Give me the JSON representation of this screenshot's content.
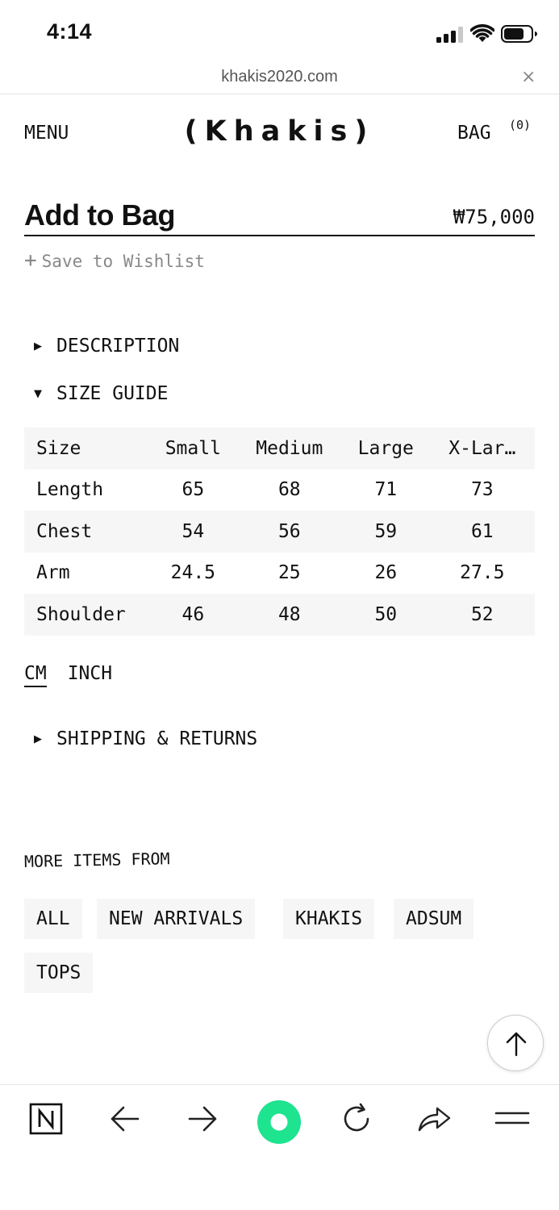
{
  "status_bar": {
    "time": "4:14"
  },
  "browser": {
    "url": "khakis2020.com",
    "close_symbol": "×"
  },
  "header": {
    "menu_label": "MENU",
    "logo": "(Khakis)",
    "bag_label": "BAG",
    "bag_count": "(0)"
  },
  "product": {
    "add_to_bag_label": "Add to Bag",
    "price": "₩75,000",
    "wishlist_plus": "+",
    "wishlist_label": "Save to Wishlist"
  },
  "accordions": {
    "description": "DESCRIPTION",
    "size_guide": "SIZE GUIDE",
    "shipping": "SHIPPING & RETURNS"
  },
  "size_table": {
    "headers": [
      "Size",
      "Small",
      "Medium",
      "Large",
      "X-Lar…"
    ],
    "rows": [
      [
        "Length",
        "65",
        "68",
        "71",
        "73"
      ],
      [
        "Chest",
        "54",
        "56",
        "59",
        "61"
      ],
      [
        "Arm",
        "24.5",
        "25",
        "26",
        "27.5"
      ],
      [
        "Shoulder",
        "46",
        "48",
        "50",
        "52"
      ]
    ]
  },
  "units": {
    "cm": "CM",
    "inch": "INCH",
    "selected": "CM"
  },
  "more_items": {
    "heading": "MORE ITEMS FROM",
    "tags": [
      "ALL",
      "NEW ARRIVALS",
      "KHAKIS",
      "ADSUM",
      "TOPS"
    ]
  },
  "toolbar": {
    "icons": [
      "notion-logo-icon",
      "back-arrow-icon",
      "forward-arrow-icon",
      "record-icon",
      "reload-icon",
      "share-icon",
      "menu-icon"
    ],
    "accent_color": "#1ee38f"
  }
}
